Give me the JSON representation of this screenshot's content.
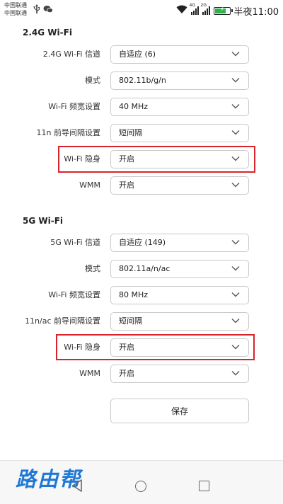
{
  "status_bar": {
    "carrier1": "中国联通",
    "carrier2": "中国联通",
    "usb_icon": "usb-icon",
    "wechat_icon": "wechat-icon",
    "wifi_icon": "wifi-icon",
    "sim1_tag": "4G",
    "sim2_tag": "2G",
    "time": "半夜11:00",
    "battery_level_percent": 85,
    "battery_color": "#2db34a"
  },
  "wifi24": {
    "title": "2.4G Wi-Fi",
    "rows": [
      {
        "label": "2.4G Wi-Fi 信道",
        "value": "自适应 (6)"
      },
      {
        "label": "模式",
        "value": "802.11b/g/n"
      },
      {
        "label": "Wi-Fi 频宽设置",
        "value": "40 MHz"
      },
      {
        "label": "11n 前导间隔设置",
        "value": "短间隔"
      },
      {
        "label": "Wi-Fi 隐身",
        "value": "开启"
      },
      {
        "label": "WMM",
        "value": "开启"
      }
    ]
  },
  "wifi5": {
    "title": "5G Wi-Fi",
    "rows": [
      {
        "label": "5G Wi-Fi 信道",
        "value": "自适应 (149)"
      },
      {
        "label": "模式",
        "value": "802.11a/n/ac"
      },
      {
        "label": "Wi-Fi 频宽设置",
        "value": "80 MHz"
      },
      {
        "label": "11n/ac 前导间隔设置",
        "value": "短间隔"
      },
      {
        "label": "Wi-Fi 隐身",
        "value": "开启"
      },
      {
        "label": "WMM",
        "value": "开启"
      }
    ]
  },
  "save_label": "保存",
  "watermark": "路由帮",
  "highlight_color": "#d9232d"
}
